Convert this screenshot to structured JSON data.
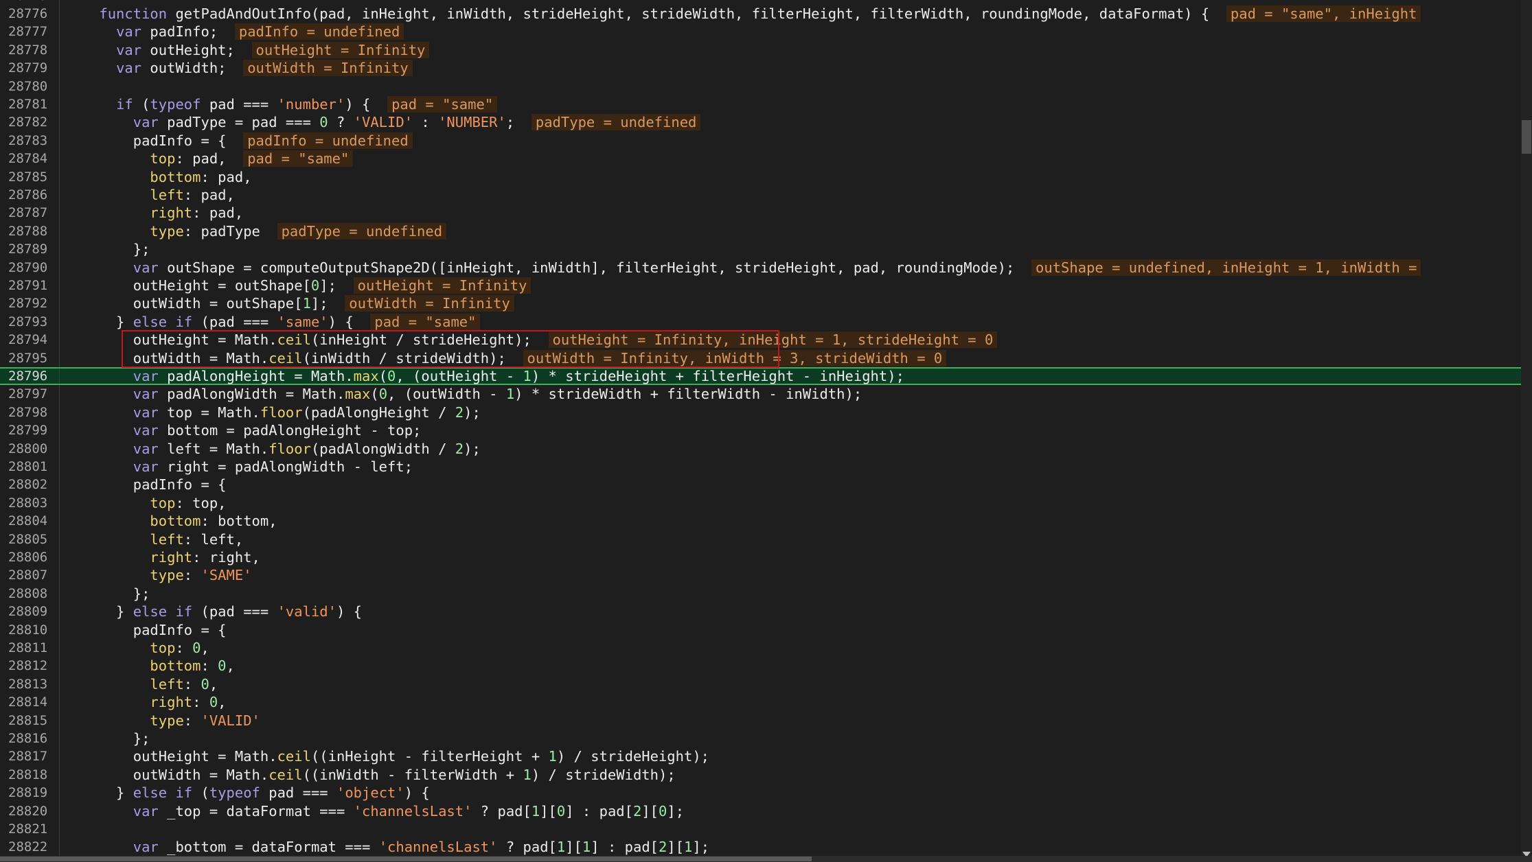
{
  "editor": {
    "colors": {
      "background": "#1e1e1e",
      "text": "#ececec",
      "keyword": "#a99ce6",
      "string": "#f2945b",
      "number": "#9ce9a8",
      "property": "#ecd16f",
      "inline_value_bg": "#3b2614",
      "inline_value_text": "#d89a62",
      "execution_line_bg": "#0b3b23",
      "execution_line_border": "#3bb05a",
      "highlight_box": "#c8141e"
    },
    "partial_top_line": "28775",
    "execution_line": 28796,
    "highlighted_box_lines": [
      "28794",
      "28795"
    ],
    "lines": [
      {
        "n": "28776",
        "t": [
          [
            "    ",
            ""
          ],
          [
            "function",
            "kw"
          ],
          [
            " getPadAndOutInfo(pad, inHeight, inWidth, strideHeight, strideWidth, filterHeight, filterWidth, roundingMode, dataFormat) {",
            ""
          ],
          [
            "  ",
            ""
          ],
          [
            "pad = \"same\", inHeight",
            "iv"
          ]
        ]
      },
      {
        "n": "28777",
        "t": [
          [
            "      ",
            ""
          ],
          [
            "var",
            "kw"
          ],
          [
            " padInfo;",
            ""
          ],
          [
            "  ",
            ""
          ],
          [
            "padInfo = undefined",
            "iv"
          ]
        ]
      },
      {
        "n": "28778",
        "t": [
          [
            "      ",
            ""
          ],
          [
            "var",
            "kw"
          ],
          [
            " outHeight;",
            ""
          ],
          [
            "  ",
            ""
          ],
          [
            "outHeight = Infinity",
            "iv"
          ]
        ]
      },
      {
        "n": "28779",
        "t": [
          [
            "      ",
            ""
          ],
          [
            "var",
            "kw"
          ],
          [
            " outWidth;",
            ""
          ],
          [
            "  ",
            ""
          ],
          [
            "outWidth = Infinity",
            "iv"
          ]
        ]
      },
      {
        "n": "28780",
        "t": []
      },
      {
        "n": "28781",
        "t": [
          [
            "      ",
            ""
          ],
          [
            "if",
            "kw"
          ],
          [
            " (",
            ""
          ],
          [
            "typeof",
            "kw"
          ],
          [
            " pad === ",
            ""
          ],
          [
            "'number'",
            "str"
          ],
          [
            ") {",
            ""
          ],
          [
            "  ",
            ""
          ],
          [
            "pad = \"same\"",
            "iv"
          ]
        ]
      },
      {
        "n": "28782",
        "t": [
          [
            "        ",
            ""
          ],
          [
            "var",
            "kw"
          ],
          [
            " padType = pad === ",
            ""
          ],
          [
            "0",
            "num"
          ],
          [
            " ? ",
            ""
          ],
          [
            "'VALID'",
            "str"
          ],
          [
            " : ",
            ""
          ],
          [
            "'NUMBER'",
            "str"
          ],
          [
            ";",
            ""
          ],
          [
            "  ",
            ""
          ],
          [
            "padType = undefined",
            "iv"
          ]
        ]
      },
      {
        "n": "28783",
        "t": [
          [
            "        padInfo = {",
            ""
          ],
          [
            "  ",
            ""
          ],
          [
            "padInfo = undefined",
            "iv"
          ]
        ]
      },
      {
        "n": "28784",
        "t": [
          [
            "          ",
            ""
          ],
          [
            "top",
            "prop"
          ],
          [
            ": pad,",
            ""
          ],
          [
            "  ",
            ""
          ],
          [
            "pad = \"same\"",
            "iv"
          ]
        ]
      },
      {
        "n": "28785",
        "t": [
          [
            "          ",
            ""
          ],
          [
            "bottom",
            "prop"
          ],
          [
            ": pad,",
            ""
          ]
        ]
      },
      {
        "n": "28786",
        "t": [
          [
            "          ",
            ""
          ],
          [
            "left",
            "prop"
          ],
          [
            ": pad,",
            ""
          ]
        ]
      },
      {
        "n": "28787",
        "t": [
          [
            "          ",
            ""
          ],
          [
            "right",
            "prop"
          ],
          [
            ": pad,",
            ""
          ]
        ]
      },
      {
        "n": "28788",
        "t": [
          [
            "          ",
            ""
          ],
          [
            "type",
            "prop"
          ],
          [
            ": padType",
            ""
          ],
          [
            "  ",
            ""
          ],
          [
            "padType = undefined",
            "iv"
          ]
        ]
      },
      {
        "n": "28789",
        "t": [
          [
            "        };",
            ""
          ]
        ]
      },
      {
        "n": "28790",
        "t": [
          [
            "        ",
            ""
          ],
          [
            "var",
            "kw"
          ],
          [
            " outShape = computeOutputShape2D([inHeight, inWidth], filterHeight, strideHeight, pad, roundingMode);",
            ""
          ],
          [
            "  ",
            ""
          ],
          [
            "outShape = undefined, inHeight = 1, inWidth =",
            "iv"
          ]
        ]
      },
      {
        "n": "28791",
        "t": [
          [
            "        outHeight = outShape[",
            ""
          ],
          [
            "0",
            "num"
          ],
          [
            "];",
            ""
          ],
          [
            "  ",
            ""
          ],
          [
            "outHeight = Infinity",
            "iv"
          ]
        ]
      },
      {
        "n": "28792",
        "t": [
          [
            "        outWidth = outShape[",
            ""
          ],
          [
            "1",
            "num"
          ],
          [
            "];",
            ""
          ],
          [
            "  ",
            ""
          ],
          [
            "outWidth = Infinity",
            "iv"
          ]
        ]
      },
      {
        "n": "28793",
        "t": [
          [
            "      } ",
            ""
          ],
          [
            "else if",
            "kw"
          ],
          [
            " (pad === ",
            ""
          ],
          [
            "'same'",
            "str"
          ],
          [
            ") {",
            ""
          ],
          [
            "  ",
            ""
          ],
          [
            "pad = \"same\"",
            "iv"
          ]
        ]
      },
      {
        "n": "28794",
        "t": [
          [
            "        outHeight = Math.",
            ""
          ],
          [
            "ceil",
            "prop"
          ],
          [
            "(inHeight / strideHeight);",
            ""
          ],
          [
            "  ",
            ""
          ],
          [
            "outHeight = Infinity, inHeight = 1, strideHeight = 0",
            "iv"
          ]
        ]
      },
      {
        "n": "28795",
        "t": [
          [
            "        outWidth = Math.",
            ""
          ],
          [
            "ceil",
            "prop"
          ],
          [
            "(inWidth / strideWidth);",
            ""
          ],
          [
            "  ",
            ""
          ],
          [
            "outWidth = Infinity, inWidth = 3, strideWidth = 0",
            "iv"
          ]
        ]
      },
      {
        "n": "28796",
        "t": [
          [
            "        ",
            ""
          ],
          [
            "var",
            "kw"
          ],
          [
            " padAlongHeight = Math.",
            ""
          ],
          [
            "max",
            "prop"
          ],
          [
            "(",
            ""
          ],
          [
            "0",
            "num"
          ],
          [
            ", (outHeight - ",
            ""
          ],
          [
            "1",
            "num"
          ],
          [
            ") * strideHeight + filterHeight - inHeight);",
            ""
          ]
        ]
      },
      {
        "n": "28797",
        "t": [
          [
            "        ",
            ""
          ],
          [
            "var",
            "kw"
          ],
          [
            " padAlongWidth = Math.",
            ""
          ],
          [
            "max",
            "prop"
          ],
          [
            "(",
            ""
          ],
          [
            "0",
            "num"
          ],
          [
            ", (outWidth - ",
            ""
          ],
          [
            "1",
            "num"
          ],
          [
            ") * strideWidth + filterWidth - inWidth);",
            ""
          ]
        ]
      },
      {
        "n": "28798",
        "t": [
          [
            "        ",
            ""
          ],
          [
            "var",
            "kw"
          ],
          [
            " top = Math.",
            ""
          ],
          [
            "floor",
            "prop"
          ],
          [
            "(padAlongHeight / ",
            ""
          ],
          [
            "2",
            "num"
          ],
          [
            ");",
            ""
          ]
        ]
      },
      {
        "n": "28799",
        "t": [
          [
            "        ",
            ""
          ],
          [
            "var",
            "kw"
          ],
          [
            " bottom = padAlongHeight - top;",
            ""
          ]
        ]
      },
      {
        "n": "28800",
        "t": [
          [
            "        ",
            ""
          ],
          [
            "var",
            "kw"
          ],
          [
            " left = Math.",
            ""
          ],
          [
            "floor",
            "prop"
          ],
          [
            "(padAlongWidth / ",
            ""
          ],
          [
            "2",
            "num"
          ],
          [
            ");",
            ""
          ]
        ]
      },
      {
        "n": "28801",
        "t": [
          [
            "        ",
            ""
          ],
          [
            "var",
            "kw"
          ],
          [
            " right = padAlongWidth - left;",
            ""
          ]
        ]
      },
      {
        "n": "28802",
        "t": [
          [
            "        padInfo = {",
            ""
          ]
        ]
      },
      {
        "n": "28803",
        "t": [
          [
            "          ",
            ""
          ],
          [
            "top",
            "prop"
          ],
          [
            ": top,",
            ""
          ]
        ]
      },
      {
        "n": "28804",
        "t": [
          [
            "          ",
            ""
          ],
          [
            "bottom",
            "prop"
          ],
          [
            ": bottom,",
            ""
          ]
        ]
      },
      {
        "n": "28805",
        "t": [
          [
            "          ",
            ""
          ],
          [
            "left",
            "prop"
          ],
          [
            ": left,",
            ""
          ]
        ]
      },
      {
        "n": "28806",
        "t": [
          [
            "          ",
            ""
          ],
          [
            "right",
            "prop"
          ],
          [
            ": right,",
            ""
          ]
        ]
      },
      {
        "n": "28807",
        "t": [
          [
            "          ",
            ""
          ],
          [
            "type",
            "prop"
          ],
          [
            ": ",
            ""
          ],
          [
            "'SAME'",
            "str"
          ]
        ]
      },
      {
        "n": "28808",
        "t": [
          [
            "        };",
            ""
          ]
        ]
      },
      {
        "n": "28809",
        "t": [
          [
            "      } ",
            ""
          ],
          [
            "else if",
            "kw"
          ],
          [
            " (pad === ",
            ""
          ],
          [
            "'valid'",
            "str"
          ],
          [
            ") {",
            ""
          ]
        ]
      },
      {
        "n": "28810",
        "t": [
          [
            "        padInfo = {",
            ""
          ]
        ]
      },
      {
        "n": "28811",
        "t": [
          [
            "          ",
            ""
          ],
          [
            "top",
            "prop"
          ],
          [
            ": ",
            ""
          ],
          [
            "0",
            "num"
          ],
          [
            ",",
            ""
          ]
        ]
      },
      {
        "n": "28812",
        "t": [
          [
            "          ",
            ""
          ],
          [
            "bottom",
            "prop"
          ],
          [
            ": ",
            ""
          ],
          [
            "0",
            "num"
          ],
          [
            ",",
            ""
          ]
        ]
      },
      {
        "n": "28813",
        "t": [
          [
            "          ",
            ""
          ],
          [
            "left",
            "prop"
          ],
          [
            ": ",
            ""
          ],
          [
            "0",
            "num"
          ],
          [
            ",",
            ""
          ]
        ]
      },
      {
        "n": "28814",
        "t": [
          [
            "          ",
            ""
          ],
          [
            "right",
            "prop"
          ],
          [
            ": ",
            ""
          ],
          [
            "0",
            "num"
          ],
          [
            ",",
            ""
          ]
        ]
      },
      {
        "n": "28815",
        "t": [
          [
            "          ",
            ""
          ],
          [
            "type",
            "prop"
          ],
          [
            ": ",
            ""
          ],
          [
            "'VALID'",
            "str"
          ]
        ]
      },
      {
        "n": "28816",
        "t": [
          [
            "        };",
            ""
          ]
        ]
      },
      {
        "n": "28817",
        "t": [
          [
            "        outHeight = Math.",
            ""
          ],
          [
            "ceil",
            "prop"
          ],
          [
            "((inHeight - filterHeight + ",
            ""
          ],
          [
            "1",
            "num"
          ],
          [
            ") / strideHeight);",
            ""
          ]
        ]
      },
      {
        "n": "28818",
        "t": [
          [
            "        outWidth = Math.",
            ""
          ],
          [
            "ceil",
            "prop"
          ],
          [
            "((inWidth - filterWidth + ",
            ""
          ],
          [
            "1",
            "num"
          ],
          [
            ") / strideWidth);",
            ""
          ]
        ]
      },
      {
        "n": "28819",
        "t": [
          [
            "      } ",
            ""
          ],
          [
            "else if",
            "kw"
          ],
          [
            " (",
            ""
          ],
          [
            "typeof",
            "kw"
          ],
          [
            " pad === ",
            ""
          ],
          [
            "'object'",
            "str"
          ],
          [
            ") {",
            ""
          ]
        ]
      },
      {
        "n": "28820",
        "t": [
          [
            "        ",
            ""
          ],
          [
            "var",
            "kw"
          ],
          [
            " _top = dataFormat === ",
            ""
          ],
          [
            "'channelsLast'",
            "str"
          ],
          [
            " ? pad[",
            ""
          ],
          [
            "1",
            "num"
          ],
          [
            "][",
            ""
          ],
          [
            "0",
            "num"
          ],
          [
            "] : pad[",
            ""
          ],
          [
            "2",
            "num"
          ],
          [
            "][",
            ""
          ],
          [
            "0",
            "num"
          ],
          [
            "];",
            ""
          ]
        ]
      },
      {
        "n": "28821",
        "t": []
      },
      {
        "n": "28822",
        "t": [
          [
            "        ",
            ""
          ],
          [
            "var",
            "kw"
          ],
          [
            " _bottom = dataFormat === ",
            ""
          ],
          [
            "'channelsLast'",
            "str"
          ],
          [
            " ? pad[",
            ""
          ],
          [
            "1",
            "num"
          ],
          [
            "][",
            ""
          ],
          [
            "1",
            "num"
          ],
          [
            "] : pad[",
            ""
          ],
          [
            "2",
            "num"
          ],
          [
            "][",
            ""
          ],
          [
            "1",
            "num"
          ],
          [
            "];",
            ""
          ]
        ]
      }
    ]
  },
  "scrollbars": {
    "vertical_thumb_fraction": 0.04,
    "vertical_position_fraction": 0.14,
    "horizontal_thumb_fraction": 0.53
  }
}
